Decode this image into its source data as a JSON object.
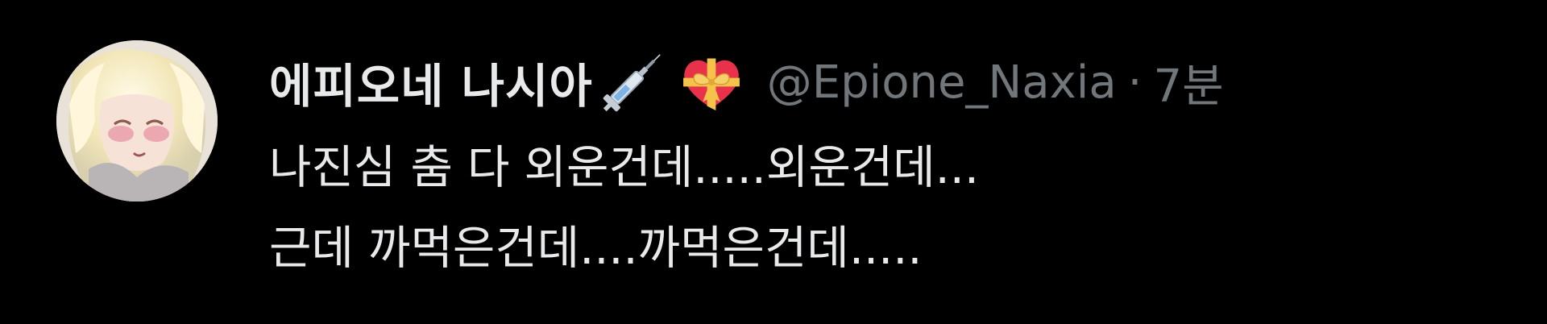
{
  "tweet": {
    "display_name": "에피오네 나시아",
    "name_emojis": [
      "syringe-icon",
      "heart-with-ribbon-icon"
    ],
    "handle": "@Epione_Naxia",
    "separator": "·",
    "time": "7분",
    "lines": [
      "나진심 춤 다 외운건데.....외운건데...",
      "근데 까먹은건데....까먹은건데....."
    ]
  },
  "colors": {
    "background": "#000000",
    "primary_text": "#e7e9ea",
    "secondary_text": "#71767b"
  }
}
